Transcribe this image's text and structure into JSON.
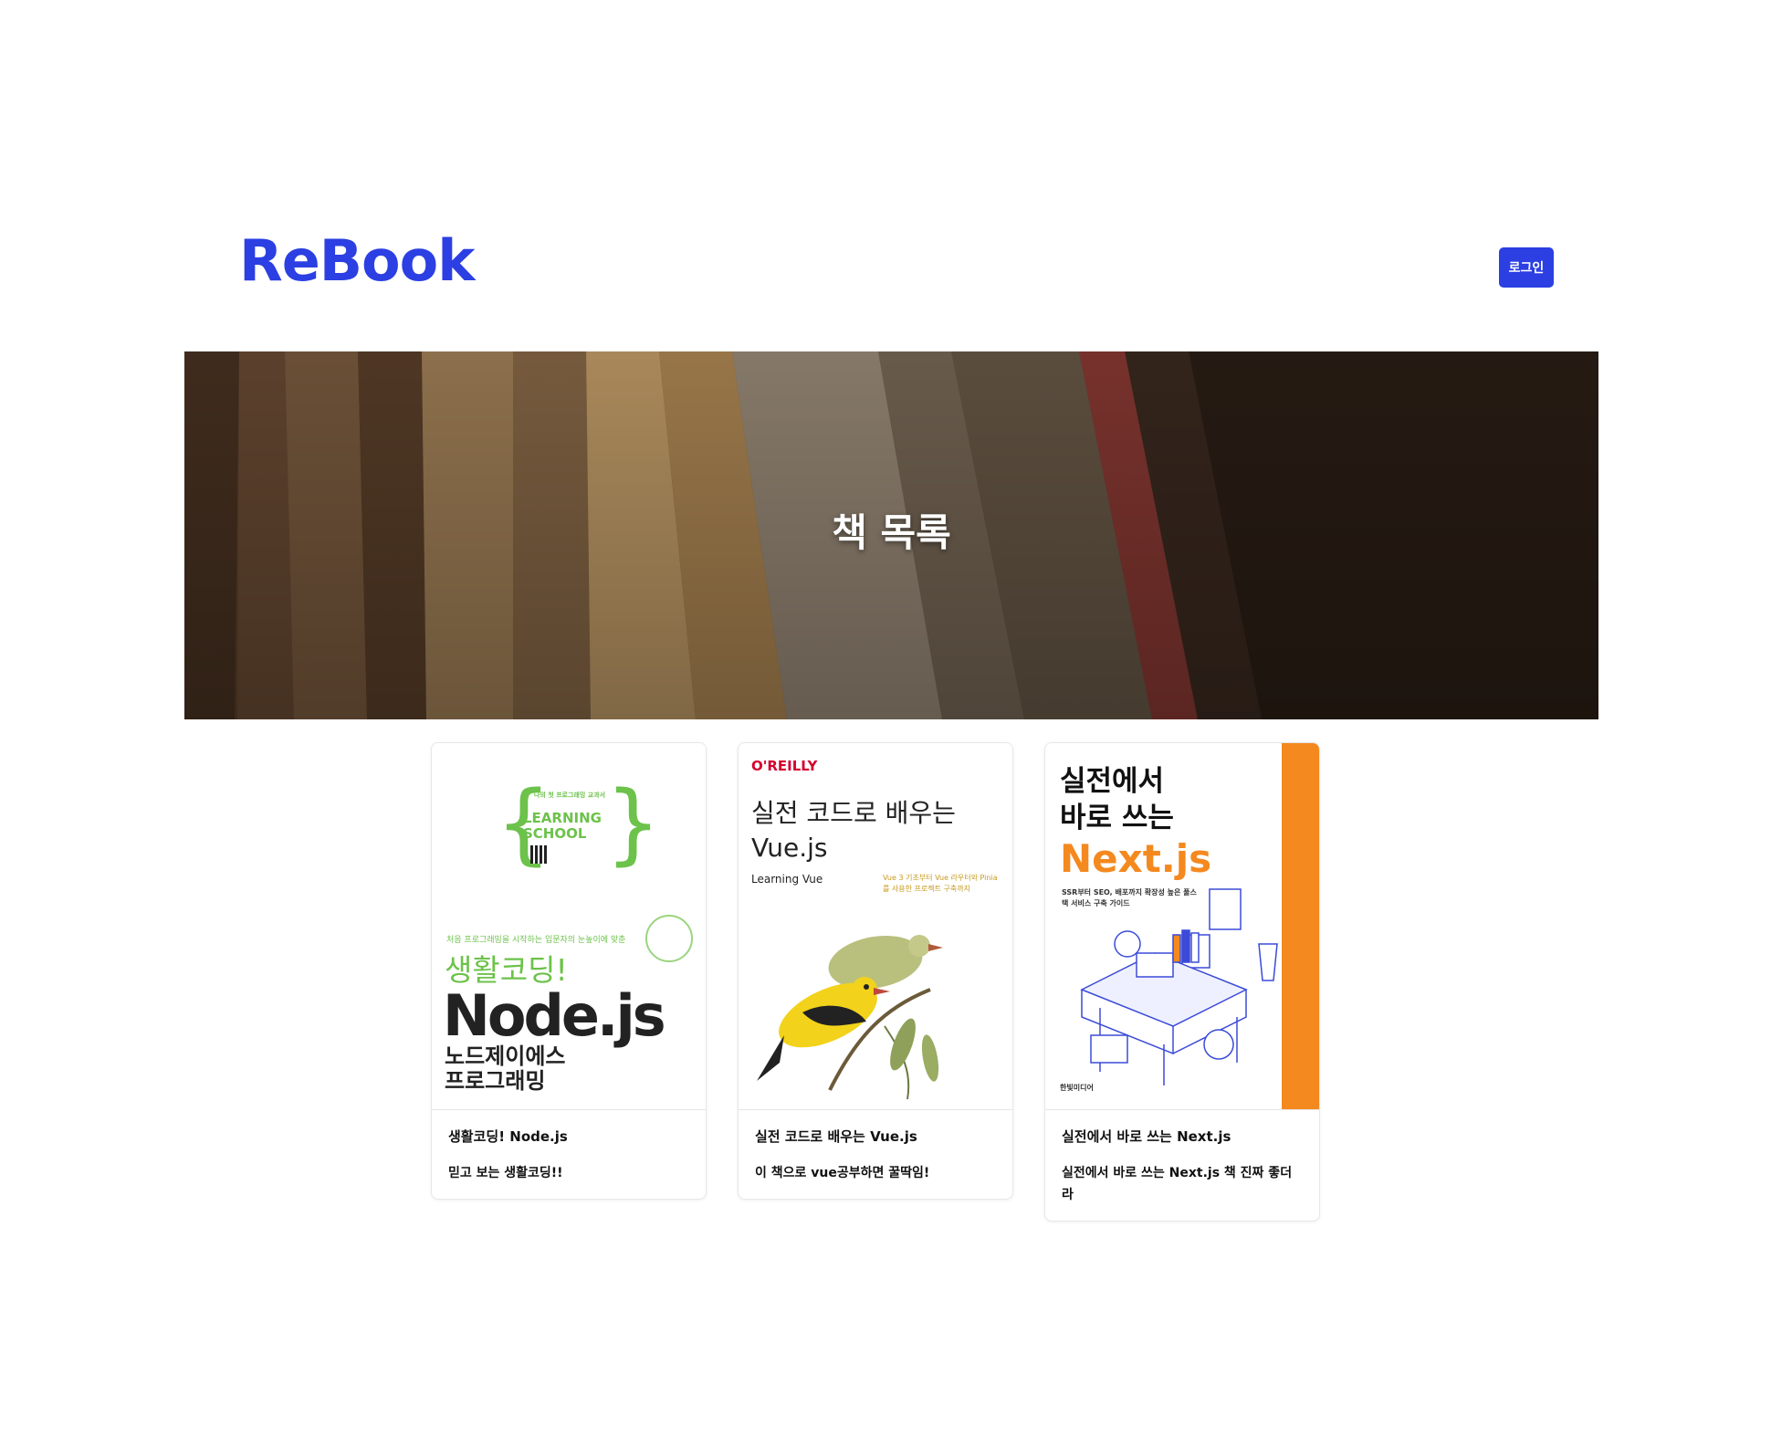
{
  "header": {
    "logo": "ReBook",
    "login_label": "로그인"
  },
  "hero": {
    "title": "책 목록"
  },
  "books": [
    {
      "title": "생활코딩! Node.js",
      "description": "믿고 보는 생활코딩!!",
      "cover": {
        "series_top": "나의 첫 프로그래밍 교과서",
        "series": "LEARNING SCHOOL",
        "subtitle": "처음 프로그래밍을 시작하는 입문자의 눈높이에 맞춘",
        "brand": "생활코딩!",
        "main": "Node.js",
        "kor": "노드제이에스 프로그래밍",
        "accent": "#6cc24a"
      }
    },
    {
      "title": "실전 코드로 배우는 Vue.js",
      "description": "이 책으로 vue공부하면 꿀딱임!",
      "cover": {
        "publisher": "O'REILLY",
        "line1": "실전 코드로 배우는",
        "line2": "Vue.js",
        "english": "Learning Vue",
        "tagline": "Vue 3 기초부터 Vue 라우터와 Pinia를 사용한 프로젝트 구축까지",
        "accent": "#d3002d"
      }
    },
    {
      "title": "실전에서 바로 쓰는 Next.js",
      "description": "실전에서 바로 쓰는 Next.js 책 진짜 좋더라",
      "cover": {
        "line1": "실전에서",
        "line2": "바로 쓰는",
        "main": "Next.js",
        "subtitle": "SSR부터 SEO, 배포까지 확장성 높은 풀스택 서비스 구축 가이드",
        "publisher": "한빛미디어",
        "accent": "#f4891f"
      }
    }
  ],
  "colors": {
    "brand": "#2b3fe3",
    "hero_bg": "#3a2a1c"
  }
}
